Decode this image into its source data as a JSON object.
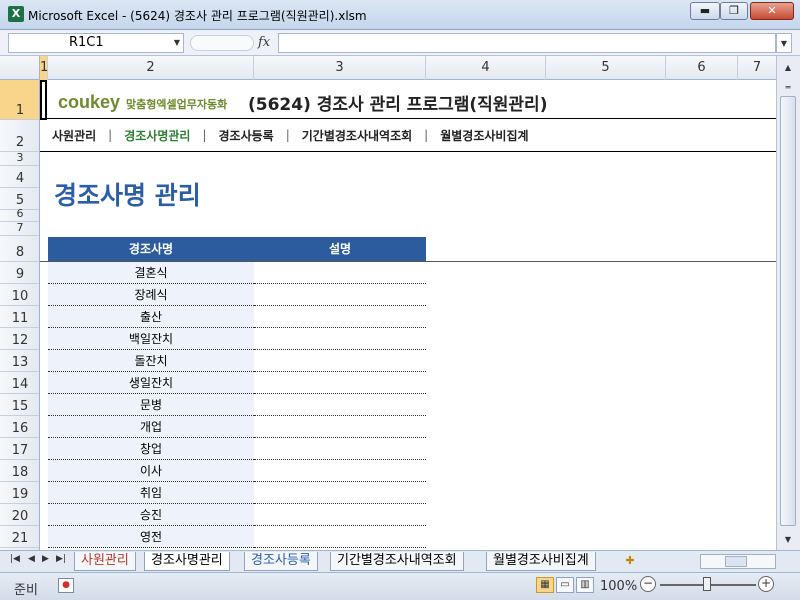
{
  "window": {
    "app_icon": "X",
    "title": "Microsoft Excel - (5624) 경조사 관리 프로그램(직원관리).xlsm",
    "minimize": "▬",
    "maximize": "❐",
    "close": "✕"
  },
  "formula_bar": {
    "name_box": "R1C1",
    "fx": "fx",
    "formula": ""
  },
  "columns": [
    "1",
    "2",
    "3",
    "4",
    "5",
    "6",
    "7"
  ],
  "rows": [
    "1",
    "2",
    "3",
    "4",
    "5",
    "6",
    "7",
    "8",
    "9",
    "10",
    "11",
    "12",
    "13",
    "14",
    "15",
    "16",
    "17",
    "18",
    "19",
    "20",
    "21"
  ],
  "header": {
    "brand": "coukey",
    "brand_sub": "맞춤형엑셀업무자동화",
    "app_title": "(5624) 경조사 관리 프로그램(직원관리)"
  },
  "nav": {
    "items": [
      "사원관리",
      "경조사명관리",
      "경조사등록",
      "기간별경조사내역조회",
      "월별경조사비집계"
    ],
    "active": 1,
    "separator": "|"
  },
  "section_title": "경조사명 관리",
  "table": {
    "headers": [
      "경조사명",
      "설명"
    ],
    "rows": [
      {
        "name": "결혼식",
        "desc": ""
      },
      {
        "name": "장례식",
        "desc": ""
      },
      {
        "name": "출산",
        "desc": ""
      },
      {
        "name": "백일잔치",
        "desc": ""
      },
      {
        "name": "돌잔치",
        "desc": ""
      },
      {
        "name": "생일잔치",
        "desc": ""
      },
      {
        "name": "문병",
        "desc": ""
      },
      {
        "name": "개업",
        "desc": ""
      },
      {
        "name": "창업",
        "desc": ""
      },
      {
        "name": "이사",
        "desc": ""
      },
      {
        "name": "취임",
        "desc": ""
      },
      {
        "name": "승진",
        "desc": ""
      },
      {
        "name": "영전",
        "desc": ""
      }
    ]
  },
  "sheet_tabs": [
    "사원관리",
    "경조사명관리",
    "경조사등록",
    "기간별경조사내역조회",
    "월별경조사비집계"
  ],
  "active_sheet": 1,
  "status": {
    "mode": "준비",
    "zoom": "100%"
  },
  "colors": {
    "brand": "#6e8a2e",
    "nav_active": "#2e7d32",
    "section_title": "#2a5ea8",
    "table_header": "#2c5c9e",
    "table_cell": "#eef3fb"
  }
}
